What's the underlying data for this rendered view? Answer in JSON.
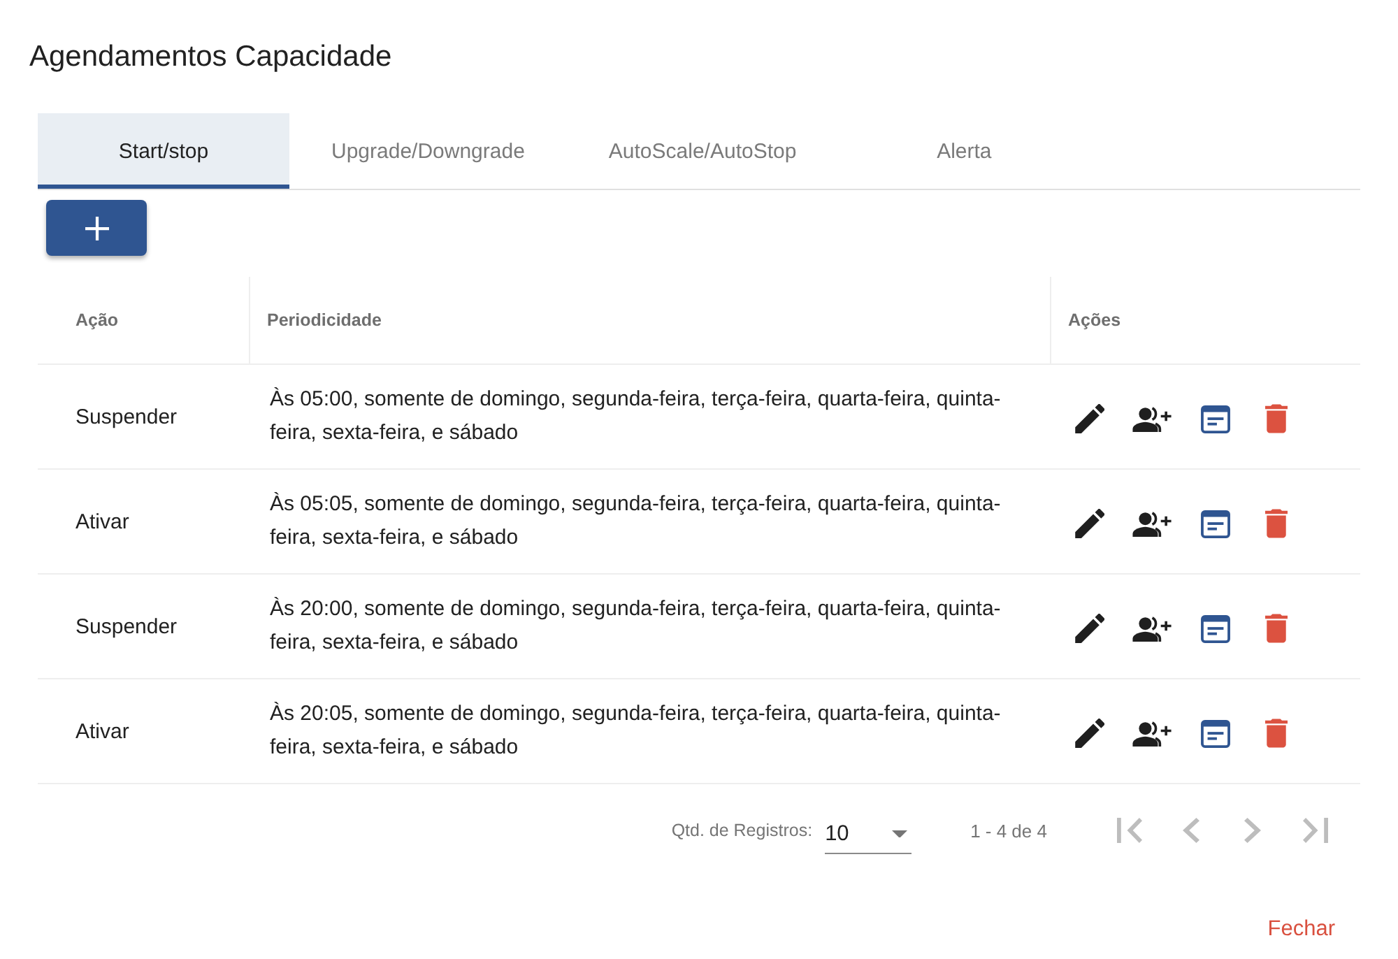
{
  "title": "Agendamentos Capacidade",
  "tabs": [
    {
      "label": "Start/stop",
      "selected": true
    },
    {
      "label": "Upgrade/Downgrade",
      "selected": false
    },
    {
      "label": "AutoScale/AutoStop",
      "selected": false
    },
    {
      "label": "Alerta",
      "selected": false
    }
  ],
  "table": {
    "columns": [
      "Ação",
      "Periodicidade",
      "Ações"
    ],
    "rows": [
      {
        "action": "Suspender",
        "schedule": "Às 05:00, somente de domingo, segunda-feira, terça-feira, quarta-feira, quinta-feira, sexta-feira, e sábado"
      },
      {
        "action": "Ativar",
        "schedule": "Às 05:05, somente de domingo, segunda-feira, terça-feira, quarta-feira, quinta-feira, sexta-feira, e sábado"
      },
      {
        "action": "Suspender",
        "schedule": "Às 20:00, somente de domingo, segunda-feira, terça-feira, quarta-feira, quinta-feira, sexta-feira, e sábado"
      },
      {
        "action": "Ativar",
        "schedule": "Às 20:05, somente de domingo, segunda-feira, terça-feira, quarta-feira, quinta-feira, sexta-feira, e sábado"
      }
    ]
  },
  "pagination": {
    "page_size_label": "Qtd. de Registros:",
    "page_size": "10",
    "range": "1 - 4 de 4",
    "nav_buttons": [
      {
        "kind": "first",
        "disabled": true
      },
      {
        "kind": "previous",
        "disabled": true
      },
      {
        "kind": "next",
        "disabled": true
      },
      {
        "kind": "last",
        "disabled": true
      }
    ]
  },
  "close_button": "Fechar"
}
